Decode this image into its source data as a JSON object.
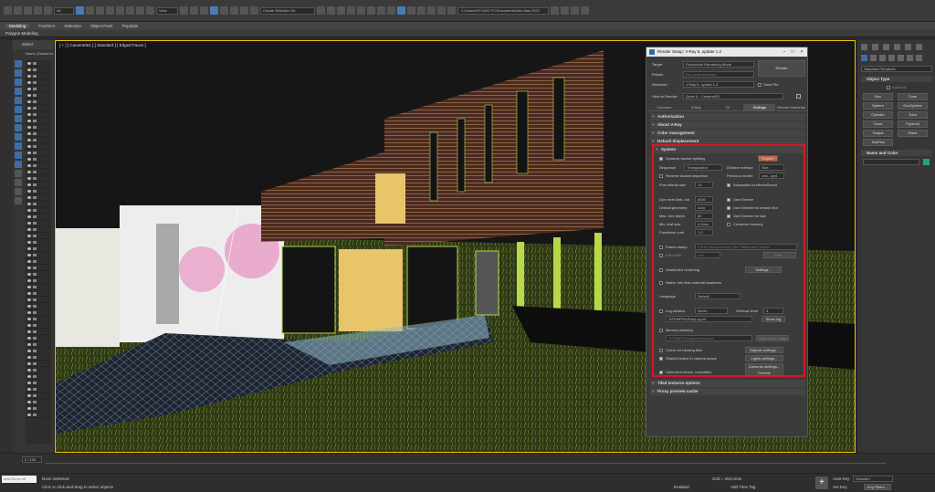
{
  "toolbar": {
    "view_dropdown": "View",
    "selection_set": "Create Selection Se",
    "file_path": "C:\\Users\\STUDIO PC\\Documents\\3ds Max 2022"
  },
  "ribbon": {
    "tabs": [
      "Modeling",
      "Freeform",
      "Selection",
      "Object Paint",
      "Populate"
    ],
    "active_tab": "Modeling",
    "sub_label": "Polygon Modeling"
  },
  "explorer": {
    "select_label": "Select",
    "column_header": "Name (Sorted As"
  },
  "viewport": {
    "label": "[ + ] [ Camera001 ] [ Standard ] [ Edged Faces ]"
  },
  "dialog": {
    "title": "Render Setup: V-Ray 5, update 1.2",
    "target_label": "Target:",
    "target_value": "Production Rendering Mode",
    "preset_label": "Preset:",
    "preset_value": "No preset selected",
    "renderer_label": "Renderer:",
    "renderer_value": "V-Ray 5, update 1.2",
    "save_file": "Save File",
    "view_label": "View to Render:",
    "view_value": "Quad 4 - Camera001",
    "render_button": "Render",
    "tabs": [
      "Common",
      "V-Ray",
      "GI",
      "Settings",
      "Render Elements"
    ],
    "active_tab": "Settings",
    "rollouts_top": [
      "Authorization",
      "About V-Ray",
      "Color management",
      "Default displacement"
    ],
    "system_title": "System",
    "dynamic_bucket": "Dynamic bucket splitting",
    "bucket_mode": "Expert",
    "sequence_label": "Sequence",
    "sequence_value": "Triangulation",
    "division_label": "Division method",
    "division_value": "Size",
    "reverse_seq": "Reverse bucket sequence",
    "previous_label": "Previous render",
    "previous_value": "Unc...ged",
    "post_effects": "Post effects rate",
    "post_effects_value": "10",
    "autoswitch": "Autoswitch to effectsResult",
    "dyn_mem": "Dyn mem limit, mb",
    "dyn_mem_value": "8000",
    "use_embree": "Use Embree",
    "default_geom": "Default geometry",
    "default_geom_value": "Auto",
    "embree_blur": "Use Embree for motion blur",
    "max_tree": "Max. tree depth",
    "max_tree_value": "80",
    "embree_hair": "Use Embree for hair",
    "min_leaf": "Min. leaf size",
    "min_leaf_value": "0.0mm",
    "conserve": "Conserve memory",
    "face_level": "Face/level coef.",
    "face_level_value": "1.0",
    "frame_stamp": "Frame stamp",
    "frame_stamp_text": "V-Ray %vrayversion | file: %filename | frame",
    "full_width": "Full width",
    "justify_value": "Left",
    "font_btn": "Font...",
    "distributed": "Distributed rendering",
    "settings_btn": "Settings...",
    "native_max": "Native 3ds Max material swatches",
    "language_label": "Language",
    "language_value": "Default",
    "log_window": "Log window",
    "log_value": "Never",
    "verbose_label": "Verbose level",
    "verbose_value": "3",
    "log_path": "%TEMP%\\VRayLog.txt",
    "show_log": "Show log",
    "memory_tracking": "Memory tracking",
    "mem_path": "%TEMP%\\vraymemtrack.txt",
    "show_mem": "Show mem usage",
    "check_missing": "Check for missing files",
    "objects_settings": "Objects settings...",
    "shade_context": "ShadeContext in camera space",
    "lights_settings": "Lights settings...",
    "optimized_atmos": "Optimized atmos. evaluation",
    "camera_settings": "Cameras settings...",
    "presets_btn": "Presets",
    "tiled_textures": "Tiled textures options",
    "proxy_cache": "Proxy preview cache"
  },
  "command_panel": {
    "category": "Standard Primitives",
    "object_type": "Object Type",
    "autogrid": "AutoGrid",
    "buttons": [
      "Box",
      "Cone",
      "Sphere",
      "GeoSphere",
      "Cylinder",
      "Tube",
      "Torus",
      "Pyramid",
      "Teapot",
      "Plane",
      "TextPlus"
    ],
    "name_color": "Name and Color",
    "accent": "#1fa37a"
  },
  "timeline": {
    "frame": "0 / 100"
  },
  "status": {
    "maxscript": "MAXScript Mi",
    "selection": "None Selected",
    "hint": "Click or click-and-drag to select objects",
    "grid": "Grid = 254,0mm",
    "enabled": "Enabled:",
    "add_time_tag": "Add Time Tag",
    "auto_key": "Auto Key",
    "set_key": "Set Key",
    "selected": "Selected",
    "key_filters": "Key Filters..."
  }
}
